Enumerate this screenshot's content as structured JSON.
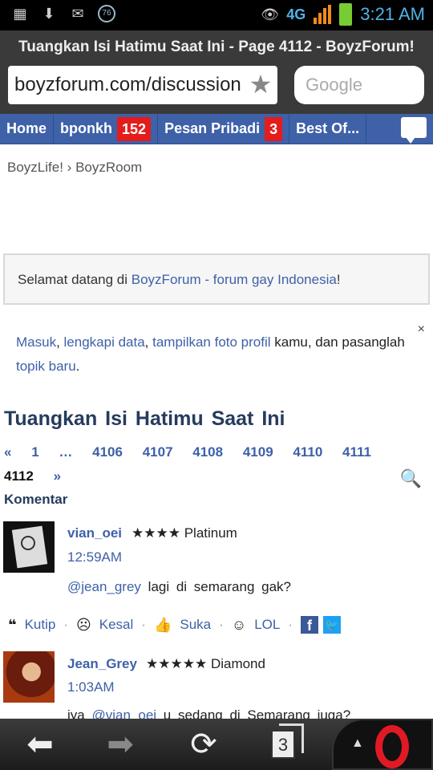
{
  "status_bar": {
    "network": "4G",
    "notification_badge": "76",
    "time": "3:21 AM"
  },
  "browser": {
    "title": "Tuangkan Isi Hatimu Saat Ini - Page 4112 - BoyzForum!",
    "url": "boyzforum.com/discussion",
    "search_placeholder": "Google",
    "tab_count": "3"
  },
  "nav": {
    "items": [
      {
        "label": "Home"
      },
      {
        "label": "bponkh",
        "badge": "152"
      },
      {
        "label": "Pesan Pribadi",
        "badge": "3"
      },
      {
        "label": "Best Of..."
      }
    ]
  },
  "breadcrumb": {
    "parts": [
      "BoyzLife!",
      "›",
      "BoyzRoom"
    ]
  },
  "welcome": {
    "prefix": "Selamat datang di ",
    "link": "BoyzForum - forum gay Indonesia",
    "suffix": "!"
  },
  "login_prompt": {
    "masuk": "Masuk",
    "sep1": ", ",
    "lengkapi": "lengkapi data",
    "sep2": ", ",
    "tampilkan": "tampilkan foto profil",
    "mid": " kamu, dan pasanglah ",
    "topik": "topik baru",
    "end": ".",
    "close": "×"
  },
  "thread": {
    "title": "Tuangkan Isi Hatimu Saat Ini",
    "section_label": "Komentar"
  },
  "pager": {
    "prev": "«",
    "pages": [
      "1",
      "…",
      "4106",
      "4107",
      "4108",
      "4109",
      "4110",
      "4111"
    ],
    "current": "4112",
    "next": "»"
  },
  "comments": [
    {
      "user": "vian_oei",
      "stars": "★★★★",
      "rank": "Platinum",
      "time": "12:59AM",
      "mention": "@jean_grey",
      "text": " lagi di semarang gak?"
    },
    {
      "user": "Jean_Grey",
      "stars": "★★★★★",
      "rank": "Diamond",
      "time": "1:03AM",
      "text_pre": "iya ",
      "mention": "@vian_oei",
      "text": " u sedang di Semarang juga?"
    }
  ],
  "actions": {
    "quote": "Kutip",
    "angry": "Kesal",
    "like": "Suka",
    "lol": "LOL",
    "separator": "·"
  }
}
